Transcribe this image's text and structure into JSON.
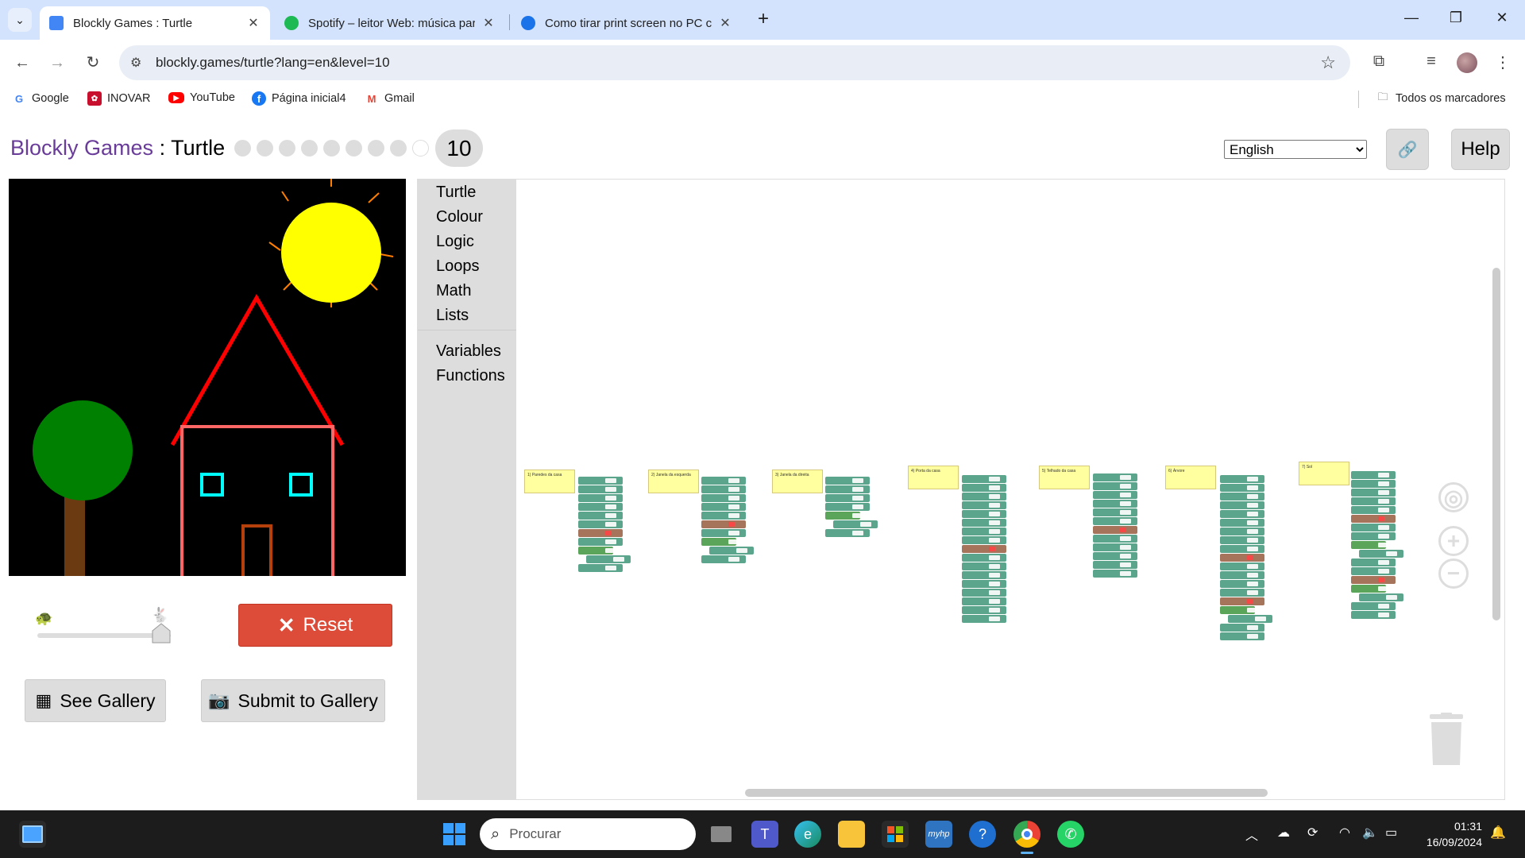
{
  "browser": {
    "tabs": [
      {
        "title": "Blockly Games : Turtle",
        "active": true,
        "favicon": "blockly-icon"
      },
      {
        "title": "Spotify – leitor Web: música par",
        "active": false,
        "favicon": "spotify-icon"
      },
      {
        "title": "Como tirar print screen no PC c",
        "active": false,
        "favicon": "tecmundo-icon"
      }
    ],
    "url": "blockly.games/turtle?lang=en&level=10",
    "bookmarks": [
      {
        "label": "Google",
        "icon": "google-icon"
      },
      {
        "label": "INOVAR",
        "icon": "inovar-icon"
      },
      {
        "label": "YouTube",
        "icon": "youtube-icon"
      },
      {
        "label": "Página inicial4",
        "icon": "facebook-icon"
      },
      {
        "label": "Gmail",
        "icon": "gmail-icon"
      }
    ],
    "all_bookmarks": "Todos os marcadores"
  },
  "page": {
    "brand": "Blockly Games",
    "separator": " : ",
    "game": "Turtle",
    "levels_completed": 7,
    "level_total": 10,
    "current_level": "10",
    "language": "English",
    "language_options": [
      "English"
    ],
    "help": "Help",
    "reset": "Reset",
    "see_gallery": "See Gallery",
    "submit_gallery": "Submit to Gallery",
    "speed_fraction": 1.0
  },
  "toolbox": {
    "categories": [
      "Turtle",
      "Colour",
      "Logic",
      "Loops",
      "Math",
      "Lists"
    ],
    "dynamic": [
      "Variables",
      "Functions"
    ]
  },
  "workspace": {
    "comments": [
      "1) Paredes da casa",
      "2) Janela da esquerda",
      "3) Janela da direita",
      "4) Porta da casa",
      "5) Telhado da casa",
      "6) Árvore",
      "7) Sol"
    ]
  },
  "colors": {
    "turtle_block": "#5ba58c",
    "loop_block": "#5ba55b",
    "colour_block": "#a5745b",
    "reset_red": "#dd4b39",
    "brand_purple": "#6a3c9a"
  },
  "taskbar": {
    "search_placeholder": "Procurar",
    "time": "01:31",
    "date": "16/09/2024"
  }
}
